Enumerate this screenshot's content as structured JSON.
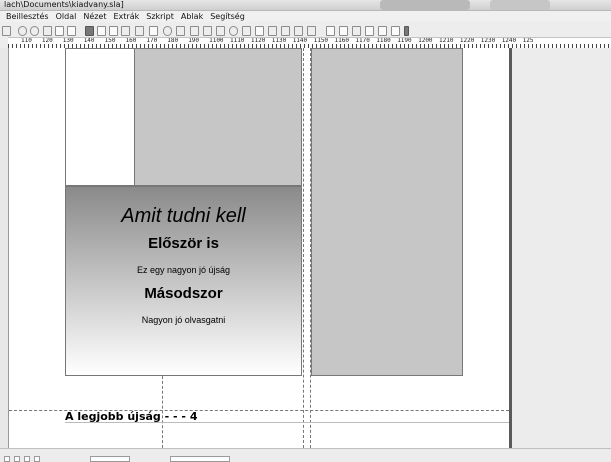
{
  "window": {
    "title": "lach\\Documents\\kiadvany.sla]"
  },
  "menu": [
    "Beillesztés",
    "Oldal",
    "Nézet",
    "Extrák",
    "Szkript",
    "Ablak",
    "Segítség"
  ],
  "ruler": {
    "labels": [
      "110",
      "120",
      "130",
      "140",
      "150",
      "160",
      "170",
      "180",
      "190",
      "1100",
      "1110",
      "1120",
      "1130",
      "1140",
      "1150",
      "1160",
      "1170",
      "1180",
      "1190",
      "1200",
      "1210",
      "1220",
      "1230",
      "1240",
      "125"
    ]
  },
  "document": {
    "headline": "Amit tudni kell",
    "heading1": "Először is",
    "body1": "Ez egy nagyon jó újság",
    "heading2": "Másodszor",
    "body2": "Nagyon jó olvasgatni",
    "footer": "A legjobb újság - - - 4"
  },
  "colors": {
    "gradient_top": "#8a8a8a",
    "gradient_bottom": "#ffffff",
    "panel_gray": "#c6c6c6",
    "divider": "#5a5a5a"
  }
}
